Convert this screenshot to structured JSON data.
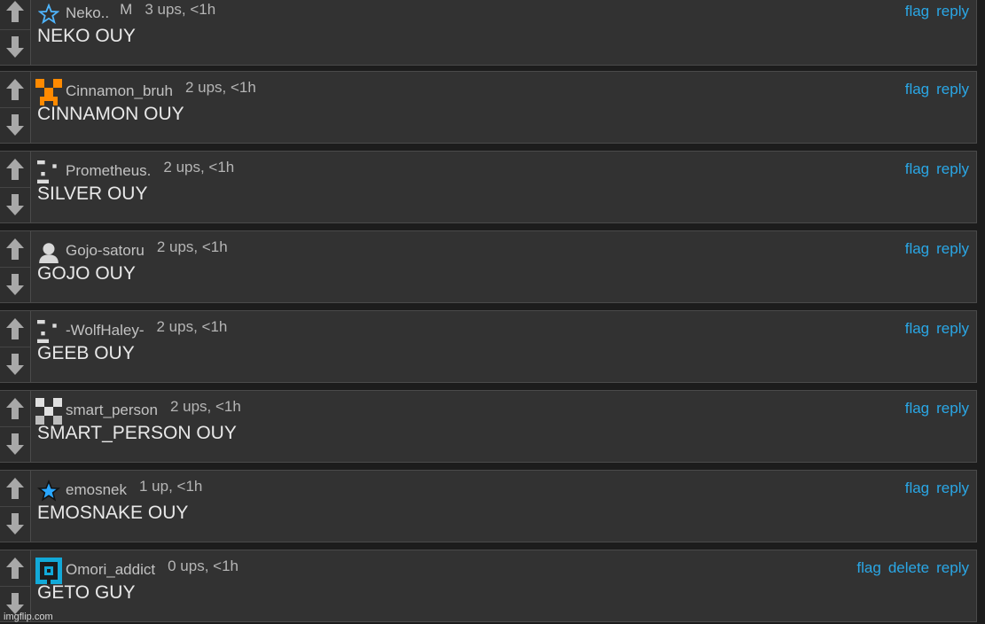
{
  "comments": [
    {
      "username": "Neko..",
      "badge": "M",
      "meta": "3 ups, <1h",
      "text": "NEKO OUY",
      "actions": [
        "flag",
        "reply"
      ],
      "avatar": "star-outline-icon"
    },
    {
      "username": "Cinnamon_bruh",
      "badge": "",
      "meta": "2 ups, <1h",
      "text": "CINNAMON OUY",
      "actions": [
        "flag",
        "reply"
      ],
      "avatar": "orange-pixel-avatar-icon"
    },
    {
      "username": "Prometheus.",
      "badge": "",
      "meta": "2 ups, <1h",
      "text": "SILVER OUY",
      "actions": [
        "flag",
        "reply"
      ],
      "avatar": "white-pixel-face-icon"
    },
    {
      "username": "Gojo-satoru",
      "badge": "",
      "meta": "2 ups, <1h",
      "text": "GOJO OUY",
      "actions": [
        "flag",
        "reply"
      ],
      "avatar": "user-silhouette-icon"
    },
    {
      "username": "-WolfHaley-",
      "badge": "",
      "meta": "2 ups, <1h",
      "text": "GEEB OUY",
      "actions": [
        "flag",
        "reply"
      ],
      "avatar": "white-pixel-face-icon"
    },
    {
      "username": "smart_person",
      "badge": "",
      "meta": "2 ups, <1h",
      "text": "SMART_PERSON OUY",
      "actions": [
        "flag",
        "reply"
      ],
      "avatar": "checker-pixel-avatar-icon"
    },
    {
      "username": "emosnek",
      "badge": "",
      "meta": "1 up, <1h",
      "text": "EMOSNAKE OUY",
      "actions": [
        "flag",
        "reply"
      ],
      "avatar": "blue-star-icon"
    },
    {
      "username": "Omori_addict",
      "badge": "",
      "meta": "0 ups, <1h",
      "text": "GETO GUY",
      "actions": [
        "flag",
        "delete",
        "reply"
      ],
      "avatar": "blue-square-avatar-icon"
    }
  ],
  "watermark": "imgflip.com",
  "colors": {
    "link": "#2aa7e6",
    "background": "#323232",
    "text": "#e8e8e8"
  }
}
